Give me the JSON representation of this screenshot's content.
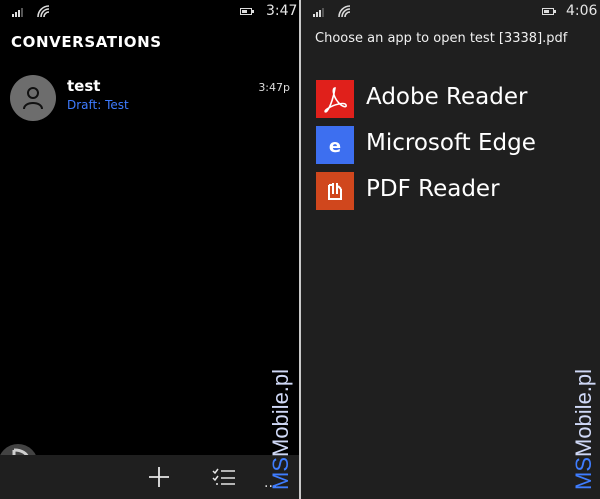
{
  "left_phone": {
    "status": {
      "time": "3:47"
    },
    "header": {
      "title": "CONVERSATIONS"
    },
    "conversations": [
      {
        "name": "test",
        "preview": "Draft: Test",
        "time": "3:47p"
      }
    ],
    "appbar": {
      "icons": [
        "plus-icon",
        "multi-select-icon",
        "more-icon"
      ],
      "more_label": "..."
    }
  },
  "right_phone": {
    "status": {
      "time": "4:06"
    },
    "prompt": "Choose an app to open test [3338].pdf",
    "apps": [
      {
        "label": "Adobe Reader",
        "icon": "adobe-reader-icon",
        "color": "#e0201b"
      },
      {
        "label": "Microsoft Edge",
        "icon": "edge-icon",
        "color": "#3d6ff0"
      },
      {
        "label": "PDF Reader",
        "icon": "pdf-reader-icon",
        "color": "#d0471d"
      }
    ]
  },
  "watermark": {
    "prefix": "MS",
    "rest": "Mobile.pl"
  },
  "colors": {
    "accent_blue": "#3e7bff",
    "divider": "#c9c9c9"
  }
}
